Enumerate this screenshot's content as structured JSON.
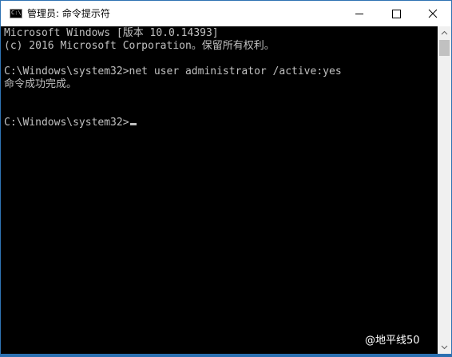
{
  "window": {
    "title": "管理员: 命令提示符"
  },
  "console": {
    "lines": [
      "Microsoft Windows [版本 10.0.14393]",
      "(c) 2016 Microsoft Corporation。保留所有权利。",
      "",
      "C:\\Windows\\system32>net user administrator /active:yes",
      "命令成功完成。",
      "",
      "",
      "C:\\Windows\\system32>"
    ]
  },
  "icons": {
    "app": "cmd-icon",
    "minimize": "minimize-icon",
    "maximize": "maximize-icon",
    "close": "close-icon"
  },
  "watermark": "@地平线50",
  "colors": {
    "console_bg": "#000000",
    "console_text": "#c0c0c0",
    "window_border": "#2f73b3"
  }
}
